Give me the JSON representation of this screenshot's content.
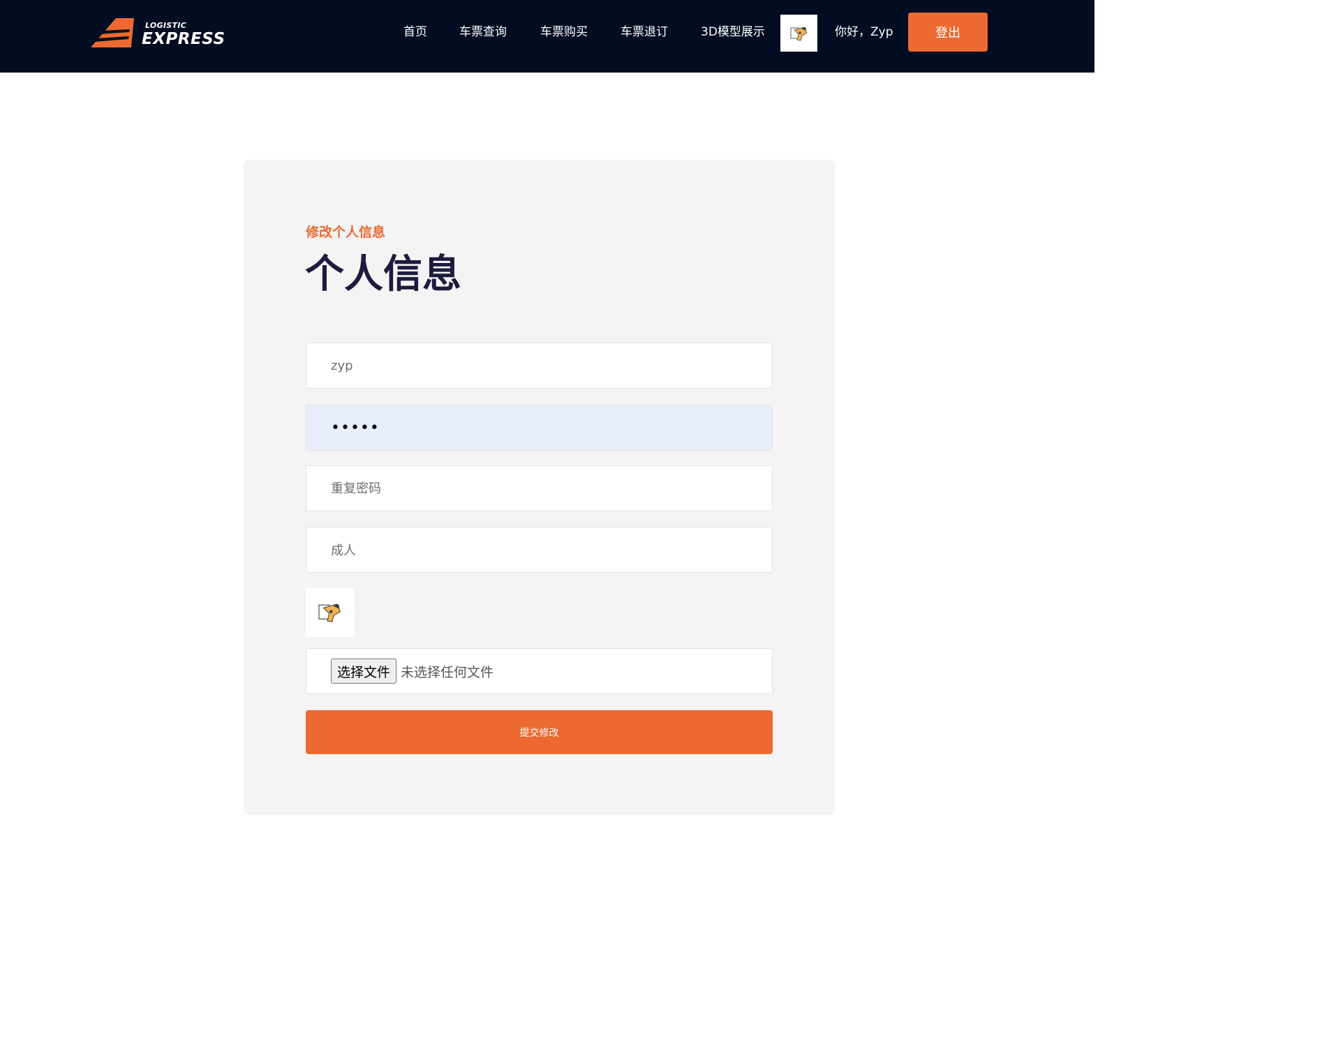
{
  "header": {
    "logo": {
      "small_text": "LOGISTIC",
      "big_text": "EXPRESS"
    },
    "nav": [
      {
        "label": "首页"
      },
      {
        "label": "车票查询"
      },
      {
        "label": "车票购买"
      },
      {
        "label": "车票退订"
      },
      {
        "label": "3D模型展示"
      }
    ],
    "avatar_icon": "avatar-image",
    "greeting": "你好，Zyp",
    "logout_label": "登出"
  },
  "profile_form": {
    "subtitle": "修改个人信息",
    "title": "个人信息",
    "username_value": "zyp",
    "password_value": "•••••",
    "repeat_password_placeholder": "重复密码",
    "user_type_value": "成人",
    "avatar_preview_icon": "avatar-image",
    "file_button_label": "选择文件",
    "file_status": "未选择任何文件",
    "submit_label": "提交修改"
  },
  "colors": {
    "header_bg": "#020d21",
    "accent": "#ec6a31",
    "card_bg": "#f4f4f4",
    "title": "#1d1b3e",
    "password_bg": "#e8effb"
  }
}
